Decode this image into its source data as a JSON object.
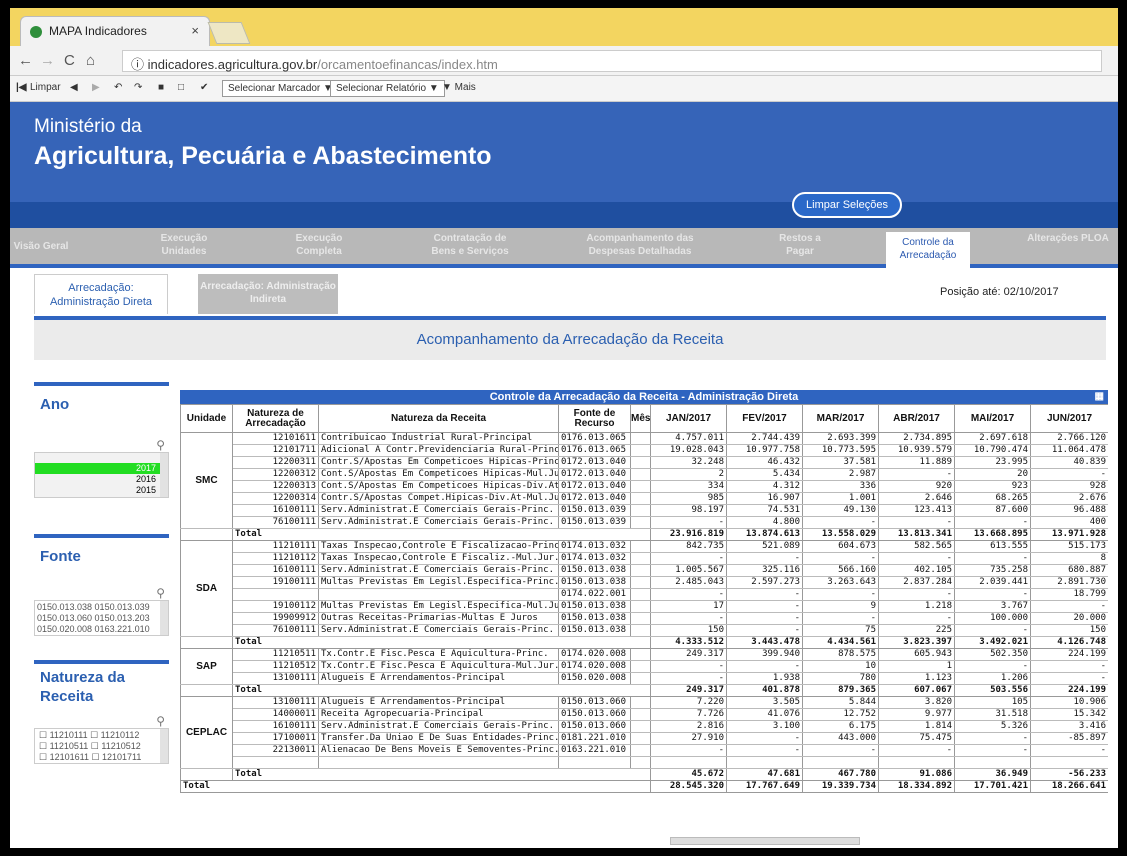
{
  "browser": {
    "tab_title": "MAPA Indicadores",
    "tab_close": "×",
    "url_host": "indicadores.agricultura.gov.br",
    "url_path": "/orcamentoefinancas/index.htm",
    "url_info": "ⓘ"
  },
  "toolbar": {
    "clear_label": "Limpar",
    "bookmark_select": "Selecionar Marcador ▼",
    "report_select": "Selecionar Relatório ▼",
    "more_label": "▼ Mais"
  },
  "header": {
    "line1": "Ministério da",
    "line2": "Agricultura, Pecuária e Abastecimento",
    "clear_selections": "Limpar Seleções"
  },
  "nav": [
    {
      "label": "Visão Geral"
    },
    {
      "label": "Execução Unidades"
    },
    {
      "label": "Execução Completa"
    },
    {
      "label": "Contratação de Bens e Serviços"
    },
    {
      "label": "Acompanhamento das Despesas Detalhadas"
    },
    {
      "label": "Restos a Pagar"
    },
    {
      "label": "Controle da Arrecadação"
    },
    {
      "label": "Alterações PLOA"
    }
  ],
  "subtabs": {
    "direct": "Arrecadação: Administração Direta",
    "indirect": "Arrecadação: Administração Indireta",
    "position": "Posição até: 02/10/2017"
  },
  "page_title": "Acompanhamento da Arrecadação da Receita",
  "filters": {
    "ano_title": "Ano",
    "ano_values": [
      "2017",
      "2016",
      "2015"
    ],
    "fonte_title": "Fonte",
    "fonte_values": [
      "0150.013.038 0150.013.039",
      "0150.013.060 0150.013.203",
      "0150.020.008 0163.221.010"
    ],
    "natureza_title": "Natureza da Receita",
    "natureza_values": [
      "11210111 ☐ 11210112",
      "11210511 ☐ 11210512",
      "12101611 ☐ 12101711"
    ]
  },
  "table": {
    "title": "Controle da Arrecadação da Receita - Administração Direta",
    "headers": [
      "Unidade",
      "Natureza de Arrecadação",
      "Natureza da Receita",
      "Fonte de Recurso",
      "Mês",
      "JAN/2017",
      "FEV/2017",
      "MAR/2017",
      "ABR/2017",
      "MAI/2017",
      "JUN/2017"
    ],
    "total_label": "Total",
    "grand_total": [
      "28.545.320",
      "17.767.649",
      "19.339.734",
      "18.334.892",
      "17.701.421",
      "18.266.641"
    ],
    "groups": [
      {
        "unit": "SMC",
        "rows": [
          [
            "12101611",
            "Contribuicao Industrial Rural-Principal",
            "0176.013.065",
            "4.757.011",
            "2.744.439",
            "2.693.399",
            "2.734.895",
            "2.697.618",
            "2.766.120"
          ],
          [
            "12101711",
            "Adicional A Contr.Previdenciaria Rural-Princ.",
            "0176.013.065",
            "19.028.043",
            "10.977.758",
            "10.773.595",
            "10.939.579",
            "10.790.474",
            "11.064.478"
          ],
          [
            "12200311",
            "Contr.S/Apostas Em Competicoes Hipicas-Princ.",
            "0172.013.040",
            "32.248",
            "46.432",
            "37.581",
            "11.889",
            "23.995",
            "40.839"
          ],
          [
            "12200312",
            "Cont.S/Apostas Em Competicoes Hipicas-Mul.Jur",
            "0172.013.040",
            "2",
            "5.434",
            "2.987",
            "-",
            "20",
            "-"
          ],
          [
            "12200313",
            "Cont.S/Apostas Em Competicoes Hipicas-Div.At.",
            "0172.013.040",
            "334",
            "4.312",
            "336",
            "920",
            "923",
            "928"
          ],
          [
            "12200314",
            "Contr.S/Apostas Compet.Hipicas-Div.At-Mul.Jur",
            "0172.013.040",
            "985",
            "16.907",
            "1.001",
            "2.646",
            "68.265",
            "2.676"
          ],
          [
            "16100111",
            "Serv.Administrat.E Comerciais Gerais-Princ.",
            "0150.013.039",
            "98.197",
            "74.531",
            "49.130",
            "123.413",
            "87.600",
            "96.488"
          ],
          [
            "76100111",
            "Serv.Administrat.E Comerciais Gerais-Princ.",
            "0150.013.039",
            "-",
            "4.800",
            "-",
            "-",
            "-",
            "400"
          ]
        ],
        "total": [
          "23.916.819",
          "13.874.613",
          "13.558.029",
          "13.813.341",
          "13.668.895",
          "13.971.928"
        ]
      },
      {
        "unit": "SDA",
        "rows": [
          [
            "11210111",
            "Taxas Inspecao,Controle E Fiscalizacao-Princ.",
            "0174.013.032",
            "842.735",
            "521.089",
            "604.673",
            "582.565",
            "613.555",
            "515.173"
          ],
          [
            "11210112",
            "Taxas Inspecao,Controle E Fiscaliz.-Mul.Jur.",
            "0174.013.032",
            "-",
            "-",
            "-",
            "-",
            "-",
            "8"
          ],
          [
            "16100111",
            "Serv.Administrat.E Comerciais Gerais-Princ.",
            "0150.013.038",
            "1.005.567",
            "325.116",
            "566.160",
            "402.105",
            "735.258",
            "680.887"
          ],
          [
            "19100111",
            "Multas Previstas Em Legisl.Especifica-Princ.",
            "0150.013.038",
            "2.485.043",
            "2.597.273",
            "3.263.643",
            "2.837.284",
            "2.039.441",
            "2.891.730"
          ],
          [
            "",
            "",
            "0174.022.001",
            "-",
            "-",
            "-",
            "-",
            "-",
            "18.799"
          ],
          [
            "19100112",
            "Multas Previstas Em Legisl.Especifica-Mul.Jur",
            "0150.013.038",
            "17",
            "-",
            "9",
            "1.218",
            "3.767",
            "-"
          ],
          [
            "19909912",
            "Outras Receitas-Primarias-Multas E Juros",
            "0150.013.038",
            "-",
            "-",
            "-",
            "-",
            "100.000",
            "20.000"
          ],
          [
            "76100111",
            "Serv.Administrat.E Comerciais Gerais-Princ.",
            "0150.013.038",
            "150",
            "-",
            "75",
            "225",
            "-",
            "150"
          ]
        ],
        "total": [
          "4.333.512",
          "3.443.478",
          "4.434.561",
          "3.823.397",
          "3.492.021",
          "4.126.748"
        ]
      },
      {
        "unit": "SAP",
        "rows": [
          [
            "11210511",
            "Tx.Contr.E Fisc.Pesca E Aquicultura-Princ.",
            "0174.020.008",
            "249.317",
            "399.940",
            "878.575",
            "605.943",
            "502.350",
            "224.199"
          ],
          [
            "11210512",
            "Tx.Contr.E Fisc.Pesca E Aquicultura-Mul.Jur.",
            "0174.020.008",
            "-",
            "-",
            "10",
            "1",
            "-",
            "-"
          ],
          [
            "13100111",
            "Alugueis E Arrendamentos-Principal",
            "0150.020.008",
            "-",
            "1.938",
            "780",
            "1.123",
            "1.206",
            "-"
          ]
        ],
        "total": [
          "249.317",
          "401.878",
          "879.365",
          "607.067",
          "503.556",
          "224.199"
        ]
      },
      {
        "unit": "CEPLAC",
        "rows": [
          [
            "13100111",
            "Alugueis E Arrendamentos-Principal",
            "0150.013.060",
            "7.220",
            "3.505",
            "5.844",
            "3.820",
            "105",
            "10.906"
          ],
          [
            "14000011",
            "Receita Agropecuaria-Principal",
            "0150.013.060",
            "7.726",
            "41.076",
            "12.752",
            "9.977",
            "31.518",
            "15.342"
          ],
          [
            "16100111",
            "Serv.Administrat.E Comerciais Gerais-Princ.",
            "0150.013.060",
            "2.816",
            "3.100",
            "6.175",
            "1.814",
            "5.326",
            "3.416"
          ],
          [
            "17100011",
            "Transfer.Da Uniao E De Suas Entidades-Princ.",
            "0181.221.010",
            "27.910",
            "-",
            "443.000",
            "75.475",
            "-",
            "-85.897"
          ],
          [
            "22130011",
            "Alienacao De Bens Moveis E Semoventes-Princ.",
            "0163.221.010",
            "-",
            "-",
            "-",
            "-",
            "-",
            "-"
          ],
          [
            "",
            "",
            "",
            "",
            "",
            "",
            "",
            "",
            ""
          ]
        ],
        "total": [
          "45.672",
          "47.681",
          "467.780",
          "91.086",
          "36.949",
          "-56.233"
        ]
      }
    ]
  }
}
